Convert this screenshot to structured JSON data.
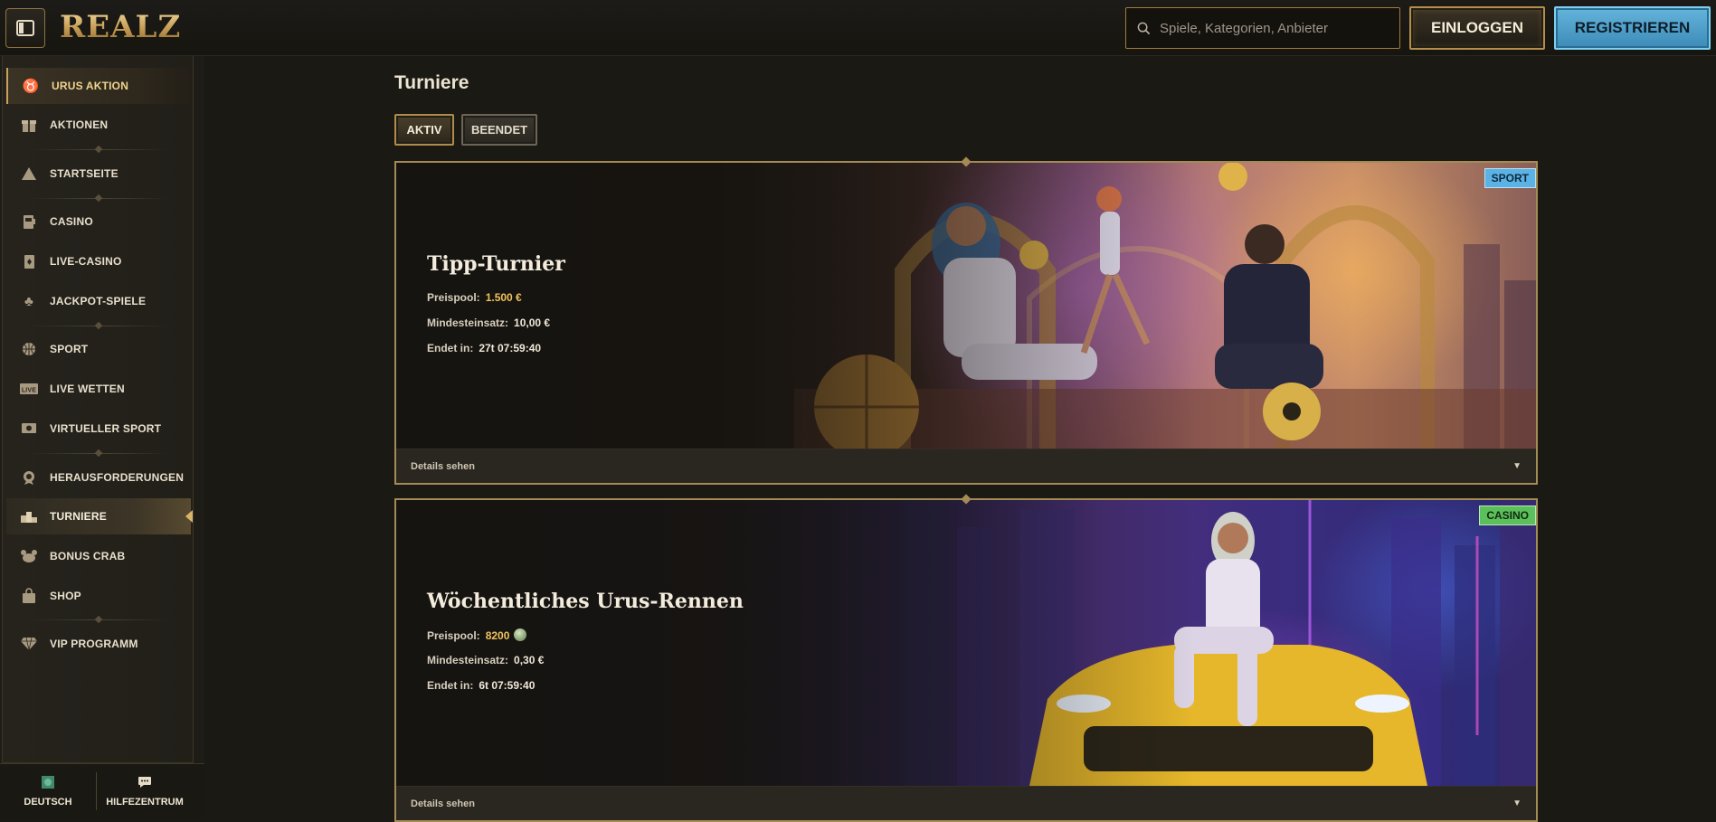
{
  "header": {
    "logo": "REALZ",
    "search_placeholder": "Spiele, Kategorien, Anbieter",
    "login_label": "EINLOGGEN",
    "register_label": "REGISTRIEREN"
  },
  "sidebar": {
    "items": [
      {
        "label": "URUS AKTION",
        "icon": "bull-icon"
      },
      {
        "label": "AKTIONEN",
        "icon": "gift-icon"
      },
      {
        "label": "STARTSEITE",
        "icon": "pyramid-icon"
      },
      {
        "label": "CASINO",
        "icon": "slot-machine-icon"
      },
      {
        "label": "LIVE-CASINO",
        "icon": "card-icon"
      },
      {
        "label": "JACKPOT-SPIELE",
        "icon": "clover-icon"
      },
      {
        "label": "SPORT",
        "icon": "ball-icon"
      },
      {
        "label": "LIVE WETTEN",
        "icon": "live-icon"
      },
      {
        "label": "VIRTUELLER SPORT",
        "icon": "virtual-sport-icon"
      },
      {
        "label": "HERAUSFORDERUNGEN",
        "icon": "medal-icon"
      },
      {
        "label": "TURNIERE",
        "icon": "podium-icon"
      },
      {
        "label": "BONUS CRAB",
        "icon": "crab-icon"
      },
      {
        "label": "SHOP",
        "icon": "shop-bag-icon"
      },
      {
        "label": "VIP PROGRAMM",
        "icon": "diamond-icon"
      }
    ],
    "footer": {
      "language_label": "DEUTSCH",
      "help_label": "HILFEZENTRUM"
    }
  },
  "main": {
    "title": "Turniere",
    "tabs": [
      {
        "label": "AKTIV",
        "active": true
      },
      {
        "label": "BEENDET",
        "active": false
      }
    ],
    "tournaments": [
      {
        "badge": "SPORT",
        "title": "Tipp-Turnier",
        "prize_label": "Preispool:",
        "prize_value": "1.500 €",
        "min_label": "Mindesteinsatz:",
        "min_value": "10,00 €",
        "ends_label": "Endet in:",
        "ends_value": "27t 07:59:40",
        "details_label": "Details sehen"
      },
      {
        "badge": "CASINO",
        "title": "Wöchentliches Urus-Rennen",
        "prize_label": "Preispool:",
        "prize_value": "8200",
        "min_label": "Mindesteinsatz:",
        "min_value": "0,30 €",
        "ends_label": "Endet in:",
        "ends_value": "6t 07:59:40",
        "details_label": "Details sehen"
      }
    ]
  },
  "colors": {
    "gold_accent": "#c8a25c",
    "sport_badge": "#5ab3e4",
    "casino_badge": "#5cc05a",
    "register_blue": "#4d9fcb"
  }
}
